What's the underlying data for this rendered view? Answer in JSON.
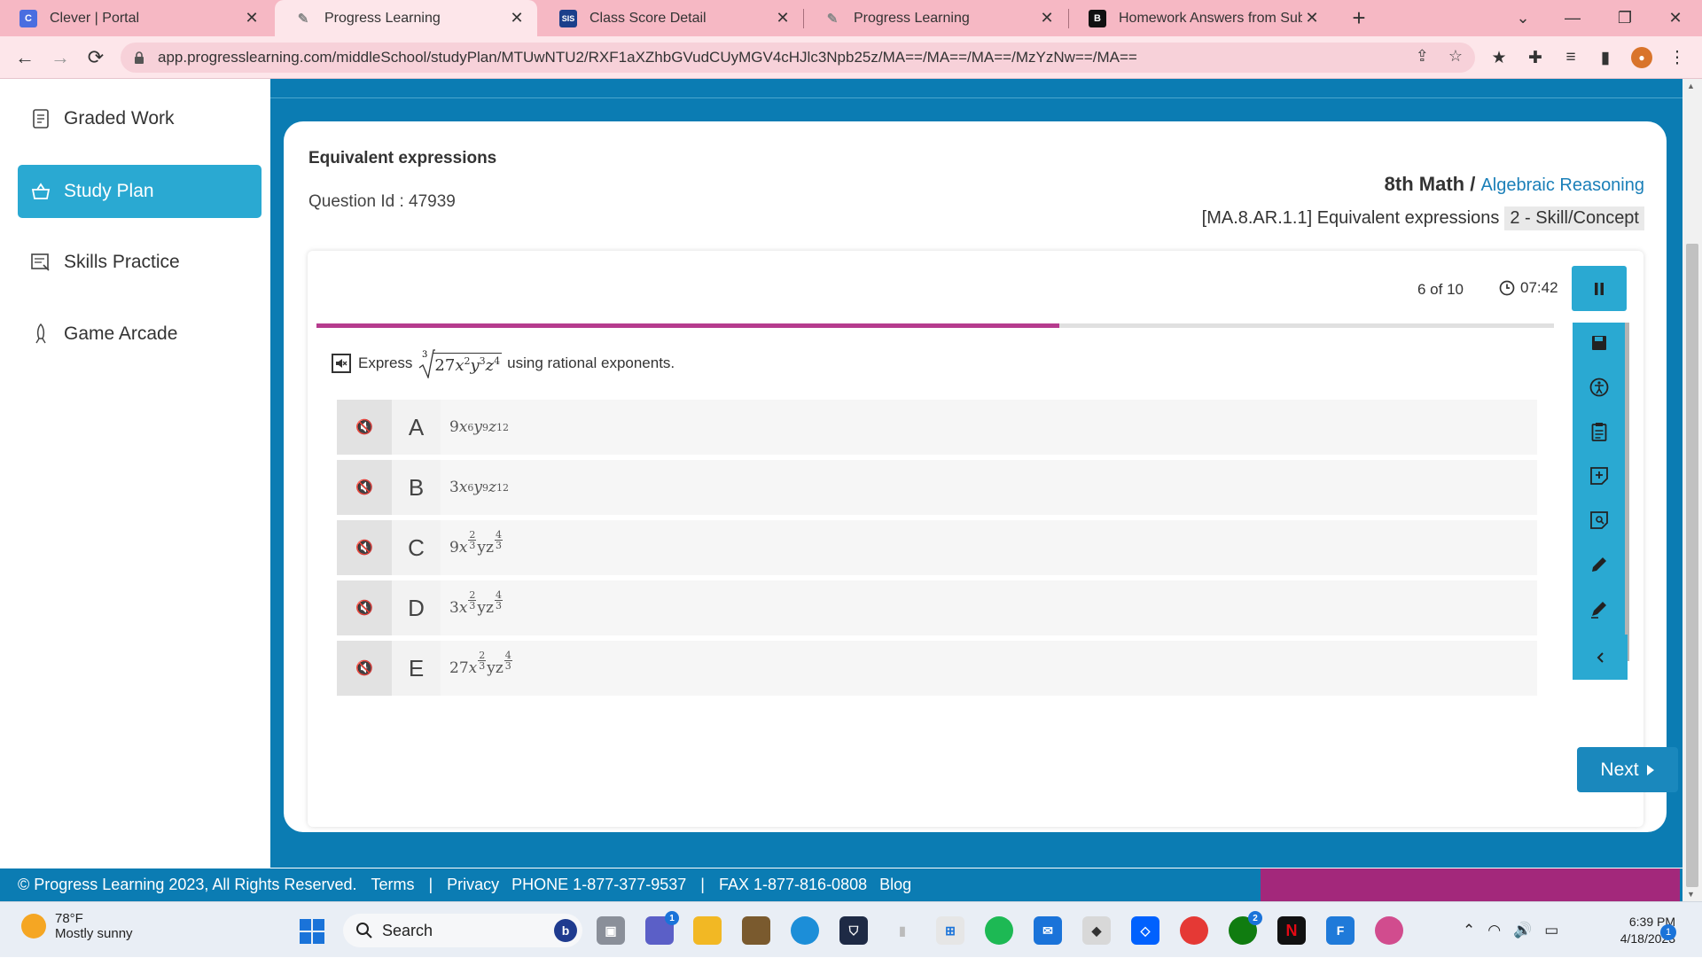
{
  "browser": {
    "tabs": [
      {
        "title": "Clever | Portal",
        "favicon": "clever-c",
        "active": false
      },
      {
        "title": "Progress Learning",
        "favicon": "progress-learning-logo",
        "active": true
      },
      {
        "title": "Class Score Detail",
        "favicon": "sis-logo",
        "active": false
      },
      {
        "title": "Progress Learning",
        "favicon": "progress-learning-logo",
        "active": false
      },
      {
        "title": "Homework Answers from Subjec",
        "favicon": "brainly-b",
        "active": false
      }
    ],
    "url": "app.progresslearning.com/middleSchool/studyPlan/MTUwNTU2/RXF1aXZhbGVudCUyMGV4cHJlc3Npb25z/MA==/MA==/MA==/MzYzNw==/MA=="
  },
  "sidebar": {
    "items": [
      {
        "label": "Graded Work",
        "icon": "graded-work-icon",
        "active": false
      },
      {
        "label": "Study Plan",
        "icon": "study-plan-icon",
        "active": true
      },
      {
        "label": "Skills Practice",
        "icon": "skills-practice-icon",
        "active": false
      },
      {
        "label": "Game Arcade",
        "icon": "rocket-icon",
        "active": false
      }
    ]
  },
  "lesson": {
    "title": "Equivalent expressions",
    "question_id": "Question Id : 47939",
    "grade": "8th Math",
    "separator": " / ",
    "domain": "Algebraic Reasoning",
    "standard": "[MA.8.AR.1.1] Equivalent expressions",
    "dok": "2 - Skill/Concept"
  },
  "quiz": {
    "counter": "6 of 10",
    "timer": "07:42",
    "progress": 0.6,
    "question_prefix": "Express",
    "question_suffix": "using rational exponents.",
    "options": [
      {
        "letter": "A",
        "coef": "9"
      },
      {
        "letter": "B",
        "coef": "3"
      },
      {
        "letter": "C",
        "coef": "9"
      },
      {
        "letter": "D",
        "coef": "3"
      },
      {
        "letter": "E",
        "coef": "27"
      }
    ],
    "next_label": "Next",
    "tools": [
      "save-icon",
      "accessibility-icon",
      "notepad-icon",
      "add-note-icon",
      "calculator-icon",
      "pencil-icon",
      "highlighter-icon",
      "eraser-icon"
    ]
  },
  "footer": {
    "copyright": "© Progress Learning 2023, All Rights Reserved.",
    "terms": "Terms",
    "sep1": "|",
    "privacy": "Privacy",
    "phone": "PHONE 1-877-377-9537",
    "sep2": "|",
    "fax": "FAX 1-877-816-0808",
    "blog": "Blog"
  },
  "taskbar": {
    "weather_temp": "78°F",
    "weather_desc": "Mostly sunny",
    "search_label": "Search",
    "time": "6:39 PM",
    "date": "4/18/2023",
    "teams_badge": "1",
    "xbox_badge": "2",
    "notif_badge": "1"
  }
}
